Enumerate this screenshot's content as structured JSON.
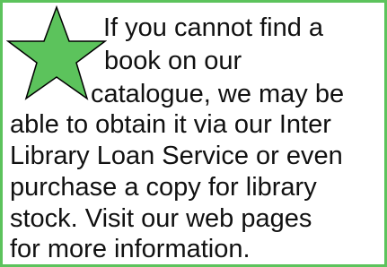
{
  "notice": {
    "lines": [
      "If you cannot find a",
      "book on our",
      "catalogue, we may be",
      "able to obtain it via our Inter",
      "Library Loan Service or even",
      "purchase a copy for library",
      "stock.  Visit our web pages",
      "for more information."
    ],
    "border_color": "#5cc35c",
    "star_color": "#5cc35c",
    "star_icon": "star-icon"
  }
}
